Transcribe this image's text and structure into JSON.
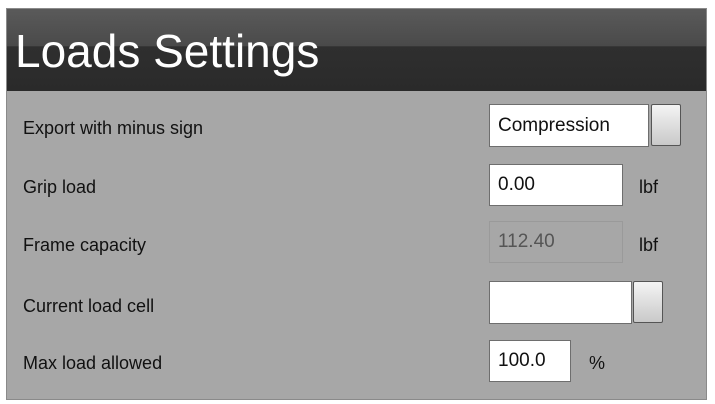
{
  "header": {
    "title": "Loads Settings"
  },
  "rows": {
    "export_minus_sign": {
      "label": "Export with minus sign",
      "value": "Compression"
    },
    "grip_load": {
      "label": "Grip load",
      "value": "0.00",
      "unit": "lbf"
    },
    "frame_capacity": {
      "label": "Frame capacity",
      "value": "112.40",
      "unit": "lbf"
    },
    "current_load_cell": {
      "label": "Current load cell",
      "value": ""
    },
    "max_load_allowed": {
      "label": "Max load allowed",
      "value": "100.0",
      "unit": "%"
    }
  }
}
